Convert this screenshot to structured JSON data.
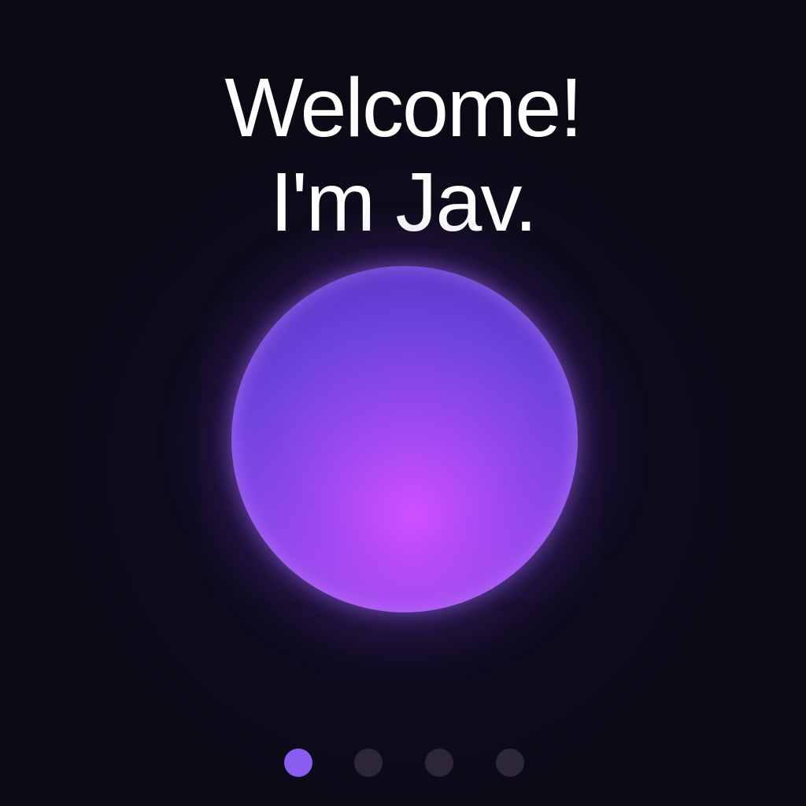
{
  "welcome": {
    "line1": "Welcome!",
    "line2": "I'm Jav."
  },
  "orb": {
    "icon": "glowing-orb",
    "colors": {
      "core": "#d050ff",
      "mid": "#8f48ec",
      "edge": "#5b39c8",
      "glow": "#8246e6"
    }
  },
  "pagination": {
    "total": 4,
    "active_index": 0,
    "colors": {
      "active": "#8a5cf0",
      "inactive": "#2c2638"
    }
  },
  "theme": {
    "background": "#0b0a14",
    "text": "#ffffff"
  }
}
